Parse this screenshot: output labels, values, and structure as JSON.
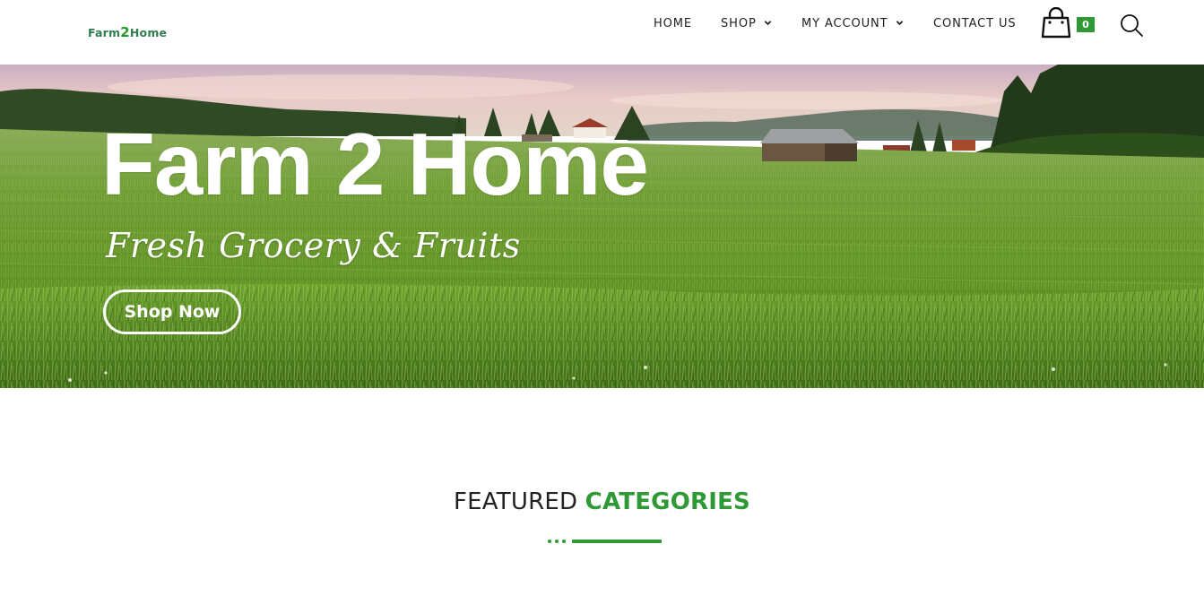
{
  "logo": {
    "part1": "Farm",
    "part2": "2",
    "part3": "Home"
  },
  "nav": {
    "items": [
      {
        "label": "HOME",
        "dropdown": false
      },
      {
        "label": "SHOP",
        "dropdown": true
      },
      {
        "label": "MY ACCOUNT",
        "dropdown": true
      },
      {
        "label": "CONTACT US",
        "dropdown": false
      }
    ],
    "cart_count": "0"
  },
  "hero": {
    "title": "Farm 2 Home",
    "subtitle": "Fresh Grocery & Fruits",
    "button_label": "Shop Now"
  },
  "featured": {
    "title_part1": "FEATURED",
    "title_part2": "CATEGORIES"
  },
  "colors": {
    "accent": "#2f9a35",
    "text": "#222222"
  }
}
